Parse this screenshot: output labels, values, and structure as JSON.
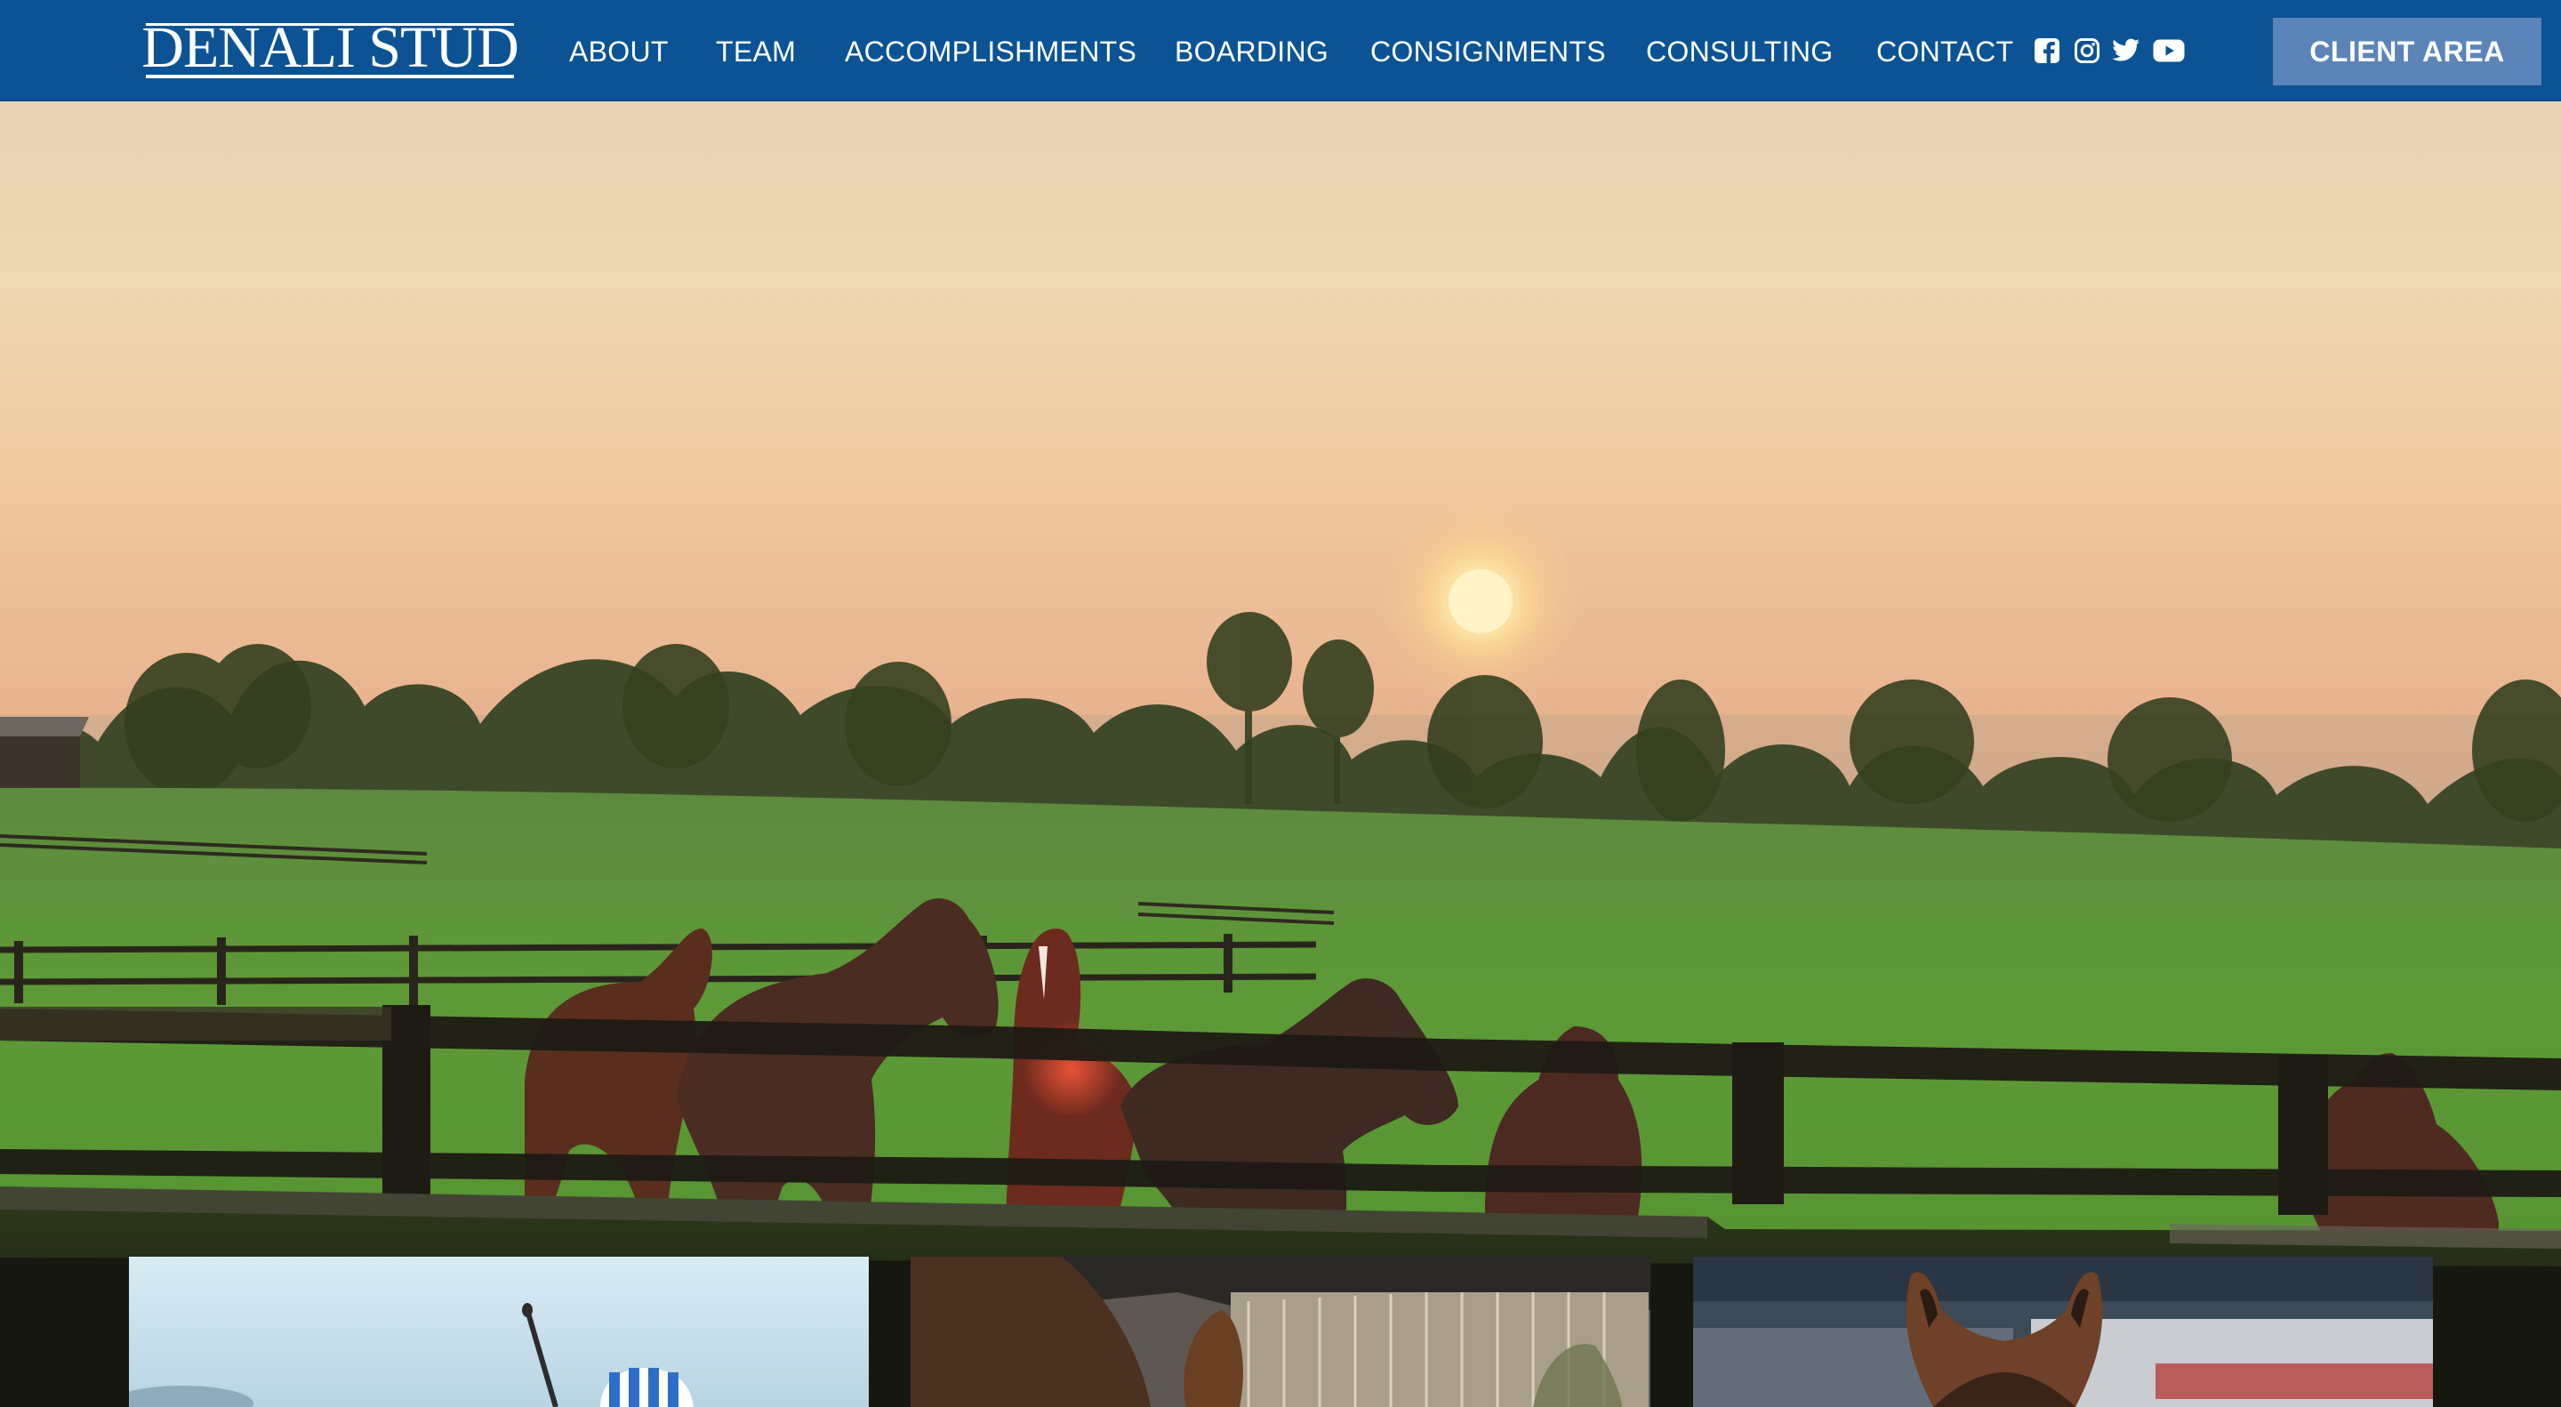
{
  "brand": {
    "name": "DENALI STUD"
  },
  "nav": {
    "items": [
      {
        "label": "ABOUT"
      },
      {
        "label": "TEAM"
      },
      {
        "label": "ACCOMPLISHMENTS"
      },
      {
        "label": "BOARDING"
      },
      {
        "label": "CONSIGNMENTS"
      },
      {
        "label": "CONSULTING"
      },
      {
        "label": "CONTACT"
      }
    ]
  },
  "social": [
    {
      "icon": "facebook-icon"
    },
    {
      "icon": "instagram-icon"
    },
    {
      "icon": "twitter-icon"
    },
    {
      "icon": "youtube-icon"
    }
  ],
  "cta": {
    "label": "CLIENT AREA"
  },
  "colors": {
    "header_bg": "#0b5394",
    "cta_bg": "#5b84b9"
  }
}
